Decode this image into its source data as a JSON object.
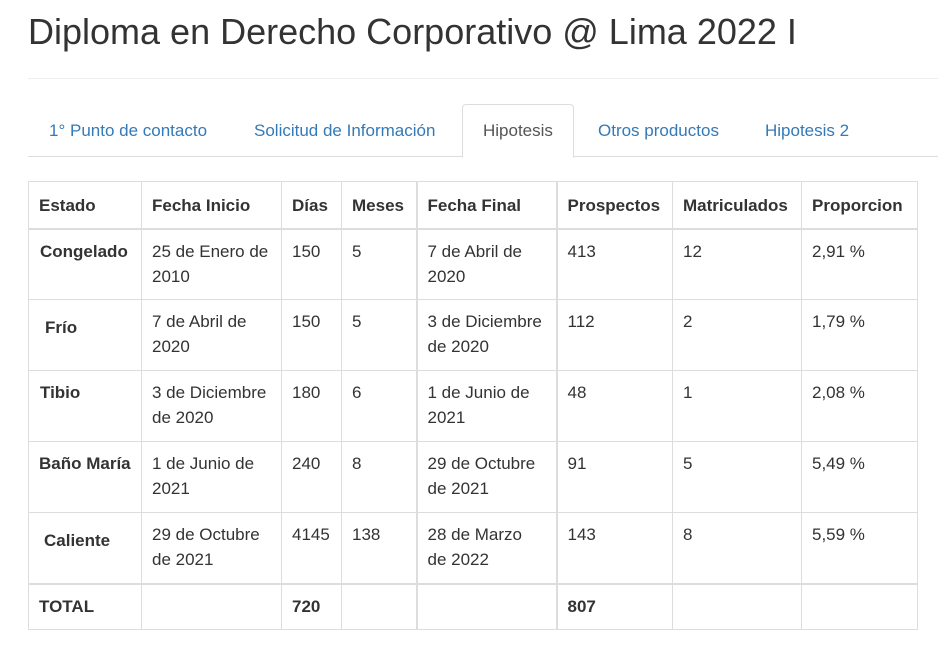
{
  "page": {
    "title": "Diploma en Derecho Corporativo @ Lima 2022 I"
  },
  "tabs": [
    {
      "label": "1° Punto de contacto",
      "active": false
    },
    {
      "label": "Solicitud de Información",
      "active": false
    },
    {
      "label": "Hipotesis",
      "active": true
    },
    {
      "label": "Otros productos",
      "active": false
    },
    {
      "label": "Hipotesis 2",
      "active": false
    }
  ],
  "table": {
    "headers": [
      "Estado",
      "Fecha Inicio",
      "Días",
      "Meses",
      "Fecha Final",
      "Prospectos",
      "Matriculados",
      "Proporcion"
    ],
    "rows": [
      {
        "estado": "Congelado",
        "fecha_inicio": "25 de Enero de 2010",
        "dias": "150",
        "meses": "5",
        "fecha_final": "7 de Abril de 2020",
        "prospectos": "413",
        "matriculados": "12",
        "proporcion": "2,91 %"
      },
      {
        "estado": "Frío",
        "fecha_inicio": "7 de Abril de 2020",
        "dias": "150",
        "meses": "5",
        "fecha_final": "3 de Diciembre de 2020",
        "prospectos": "112",
        "matriculados": "2",
        "proporcion": "1,79 %"
      },
      {
        "estado": "Tibio",
        "fecha_inicio": "3 de Diciembre de 2020",
        "dias": "180",
        "meses": "6",
        "fecha_final": "1 de Junio de 2021",
        "prospectos": "48",
        "matriculados": "1",
        "proporcion": "2,08 %"
      },
      {
        "estado": "Baño María",
        "fecha_inicio": "1 de Junio de 2021",
        "dias": "240",
        "meses": "8",
        "fecha_final": "29 de Octubre de 2021",
        "prospectos": "91",
        "matriculados": "5",
        "proporcion": "5,49 %"
      },
      {
        "estado": "Caliente",
        "fecha_inicio": "29 de Octubre de 2021",
        "dias": "4145",
        "meses": "138",
        "fecha_final": "28 de Marzo de 2022",
        "prospectos": "143",
        "matriculados": "8",
        "proporcion": "5,59 %"
      }
    ],
    "total": {
      "label": "TOTAL",
      "dias": "720",
      "prospectos": "807"
    }
  }
}
